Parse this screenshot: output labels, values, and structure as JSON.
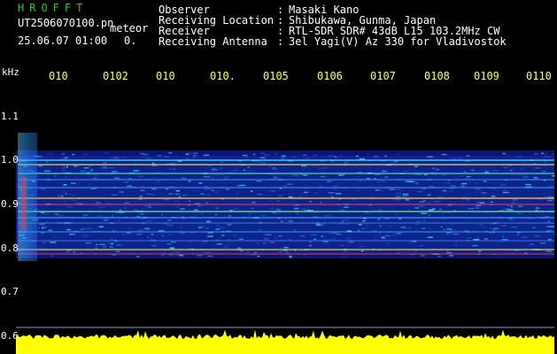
{
  "header": {
    "app_title": "HROFFT",
    "file_name": "UT2506070100.pn",
    "meteor_label": "meteor",
    "date_time": "25.06.07 01:00",
    "extra_value": "0.",
    "info": [
      {
        "label": "Observer",
        "value": "Masaki Kano"
      },
      {
        "label": "Receiving Location",
        "value": "Shibukawa, Gunma, Japan"
      },
      {
        "label": "Receiver",
        "value": "RTL-SDR SDR# 43dB L15 103.2MHz CW"
      },
      {
        "label": "Receiving Antenna",
        "value": "3el Yagi(V) Az 330 for Vladivostok"
      }
    ]
  },
  "axes": {
    "unit_label": "kHz",
    "y_ticks": [
      "1.1",
      "1.0",
      "0.9",
      "0.8",
      "0.7",
      "0.6"
    ],
    "x_ticks": [
      "010",
      "0102",
      "010",
      "010.",
      "0105",
      "0106",
      "0107",
      "0108",
      "0109",
      "0110"
    ]
  },
  "colors": {
    "title": "#1fd21f",
    "tick": "#ffff66",
    "trace": "#ffff00",
    "background": "#000000"
  }
}
